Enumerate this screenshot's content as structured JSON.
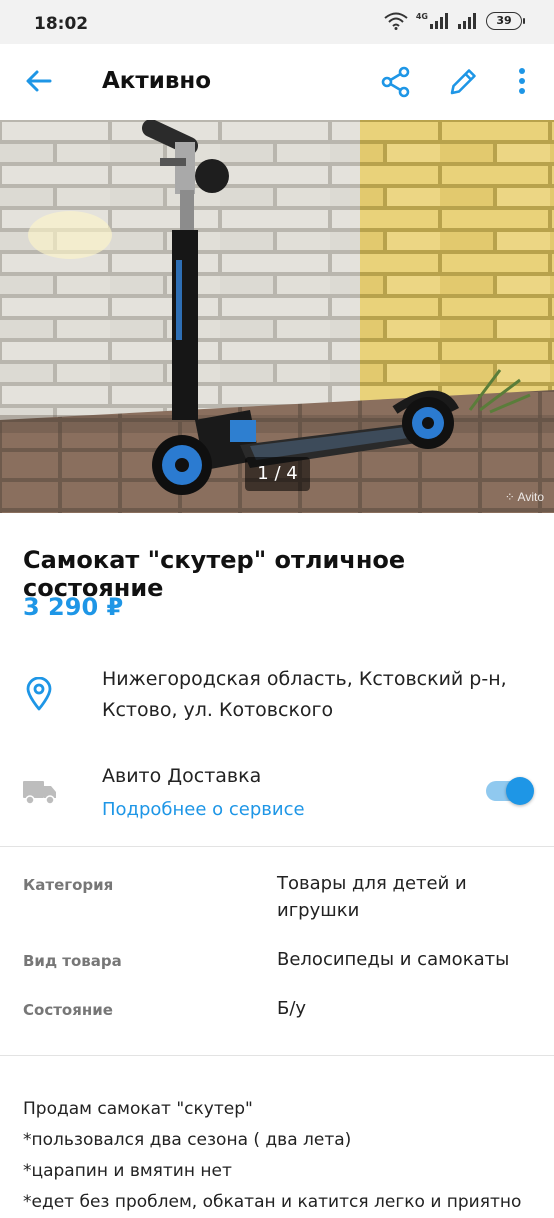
{
  "status_bar": {
    "time": "18:02",
    "network": "4G",
    "battery": "39"
  },
  "toolbar": {
    "title": "Активно",
    "icons": [
      "back-arrow-icon",
      "share-icon",
      "edit-icon",
      "more-vert-icon"
    ],
    "accent_color": "#1e96e6"
  },
  "gallery": {
    "counter": "1 / 4",
    "watermark": "Avito"
  },
  "listing": {
    "title": "Самокат \"скутер\" отличное состояние",
    "price": "3 290 ₽",
    "address_line1": "Нижегородская область, Кстовский р-н,",
    "address_line2": "Кстово, ул. Котовского"
  },
  "delivery": {
    "title": "Авито Доставка",
    "link": "Подробнее о сервисе",
    "enabled": true
  },
  "params": [
    {
      "label": "Категория",
      "value_line1": "Товары для детей и",
      "value_line2": "игрушки"
    },
    {
      "label": "Вид товара",
      "value_line1": "Велосипеды и самокаты"
    },
    {
      "label": "Состояние",
      "value_line1": "Б/у"
    }
  ],
  "description": [
    "Продам самокат \"скутер\"",
    "*пользовался два сезона ( два лета)",
    "*царапин и вмятин нет",
    "*едет без проблем, обкатан и катится легко и приятно"
  ]
}
